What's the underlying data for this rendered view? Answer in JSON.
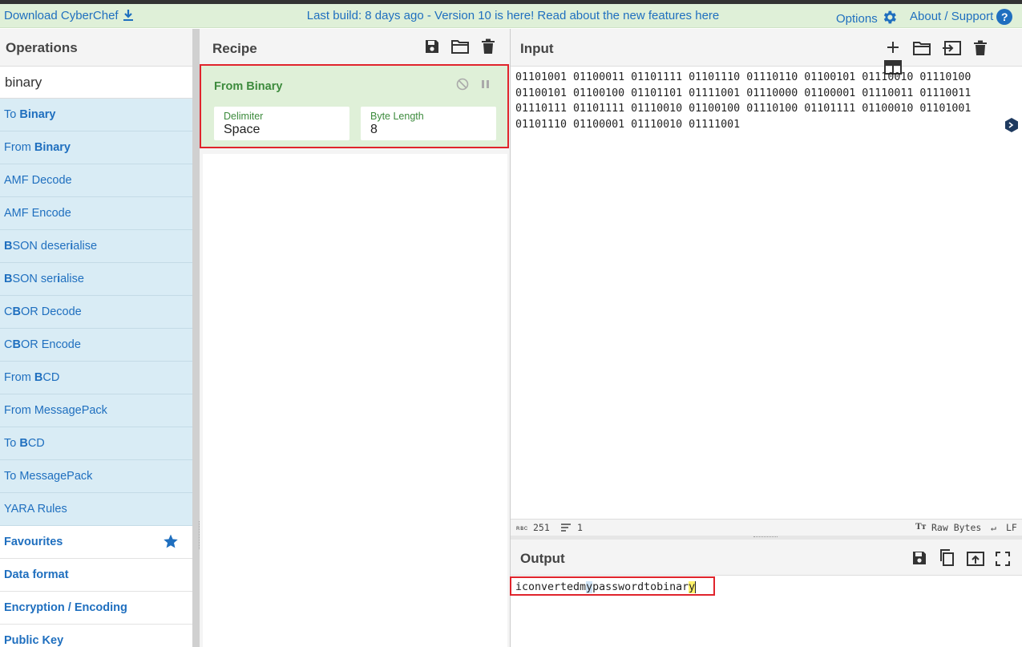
{
  "banner": {
    "download_label": "Download CyberChef",
    "message": "Last build: 8 days ago - Version 10 is here! Read about the new features here",
    "options_label": "Options",
    "about_label": "About / Support",
    "about_icon_glyph": "?"
  },
  "operations": {
    "title": "Operations",
    "search_value": "binary",
    "results": [
      {
        "pre": "To ",
        "bold": "Binary",
        "post": ""
      },
      {
        "pre": "From ",
        "bold": "Binary",
        "post": ""
      },
      {
        "pre": "AMF Decode",
        "bold": "",
        "post": ""
      },
      {
        "pre": "AMF Encode",
        "bold": "",
        "post": ""
      },
      {
        "pre": "",
        "bold": "B",
        "post": "SON deser",
        "bold2": "i",
        "post2": "alise"
      },
      {
        "pre": "",
        "bold": "B",
        "post": "SON ser",
        "bold2": "i",
        "post2": "alise"
      },
      {
        "pre": "C",
        "bold": "B",
        "post": "OR Decode"
      },
      {
        "pre": "C",
        "bold": "B",
        "post": "OR Encode"
      },
      {
        "pre": "From ",
        "bold": "B",
        "post": "CD"
      },
      {
        "pre": "From MessagePack",
        "bold": "",
        "post": ""
      },
      {
        "pre": "To ",
        "bold": "B",
        "post": "CD"
      },
      {
        "pre": "To MessagePack",
        "bold": "",
        "post": ""
      },
      {
        "pre": "YARA Rules",
        "bold": "",
        "post": ""
      }
    ],
    "categories": [
      "Favourites",
      "Data format",
      "Encryption / Encoding",
      "Public Key"
    ]
  },
  "recipe": {
    "title": "Recipe",
    "operation": {
      "name": "From Binary",
      "delimiter_label": "Delimiter",
      "delimiter_value": "Space",
      "byte_length_label": "Byte Length",
      "byte_length_value": "8"
    }
  },
  "input": {
    "title": "Input",
    "text": "01101001 01100011 01101111 01101110 01110110 01100101 01110010 01110100\n01100101 01100100 01101101 01111001 01110000 01100001 01110011 01110011\n01110111 01101111 01110010 01100100 01110100 01101111 01100010 01101001\n01101110 01100001 01110010 01111001",
    "length": "251",
    "lines": "1",
    "encoding_label": "Raw Bytes",
    "eol_label": "LF"
  },
  "output": {
    "title": "Output",
    "text_a": "iconvertedm",
    "text_b": "y",
    "text_c": "passwordtobinar",
    "text_d": "y"
  },
  "colors": {
    "accent_blue": "#1f6fbf",
    "banner_green": "#dff0d8",
    "op_result_bg": "#d9ecf5",
    "highlight_red": "#e0242c"
  }
}
